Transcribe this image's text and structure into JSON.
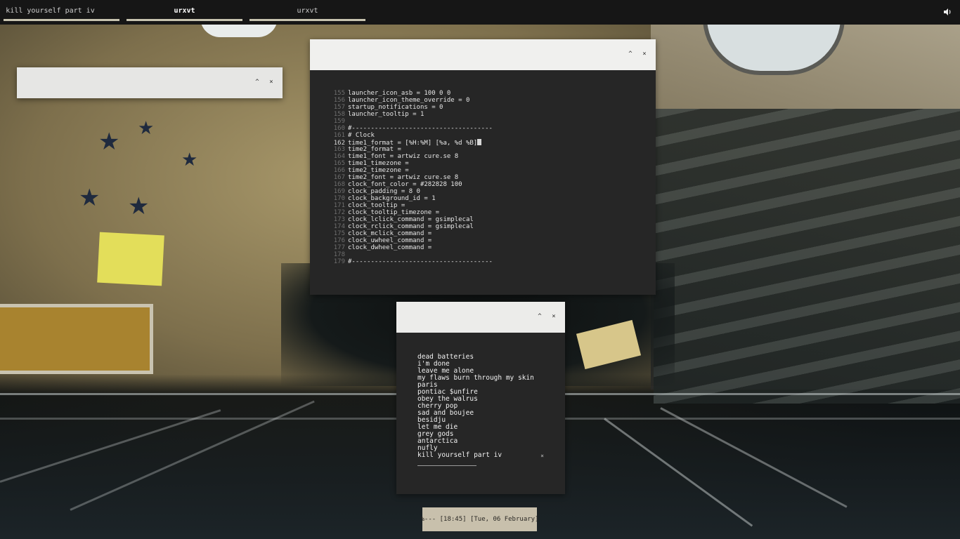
{
  "taskbar": {
    "tasks": [
      {
        "label": "kill yourself part iv",
        "active": false
      },
      {
        "label": "urxvt",
        "active": true
      },
      {
        "label": "urxvt",
        "active": false
      }
    ],
    "volume_icon": "speaker-icon"
  },
  "window_buttons": {
    "minimize": "^",
    "close": "×"
  },
  "terminal": {
    "lines": [
      {
        "n": "155",
        "text": "launcher_icon_asb = 100 0 0"
      },
      {
        "n": "156",
        "text": "launcher_icon_theme_override = 0"
      },
      {
        "n": "157",
        "text": "startup_notifications = 0"
      },
      {
        "n": "158",
        "text": "launcher_tooltip = 1"
      },
      {
        "n": "159",
        "text": ""
      },
      {
        "n": "160",
        "text": "#-------------------------------------"
      },
      {
        "n": "161",
        "text": "# Clock"
      },
      {
        "n": "162",
        "text": "time1_format = [%H:%M] [%a, %d %B]",
        "current": true
      },
      {
        "n": "163",
        "text": "time2_format ="
      },
      {
        "n": "164",
        "text": "time1_font = artwiz cure.se 8"
      },
      {
        "n": "165",
        "text": "time1_timezone ="
      },
      {
        "n": "166",
        "text": "time2_timezone ="
      },
      {
        "n": "167",
        "text": "time2_font = artwiz cure.se 8"
      },
      {
        "n": "168",
        "text": "clock_font_color = #282828 100"
      },
      {
        "n": "169",
        "text": "clock_padding = 8 0"
      },
      {
        "n": "170",
        "text": "clock_background_id = 1"
      },
      {
        "n": "171",
        "text": "clock_tooltip ="
      },
      {
        "n": "172",
        "text": "clock_tooltip_timezone ="
      },
      {
        "n": "173",
        "text": "clock_lclick_command = gsimplecal"
      },
      {
        "n": "174",
        "text": "clock_rclick_command = gsimplecal"
      },
      {
        "n": "175",
        "text": "clock_mclick_command ="
      },
      {
        "n": "176",
        "text": "clock_uwheel_command ="
      },
      {
        "n": "177",
        "text": "clock_dwheel_command ="
      },
      {
        "n": "178",
        "text": ""
      },
      {
        "n": "179",
        "text": "#-------------------------------------"
      }
    ]
  },
  "playlist": {
    "items": [
      "dead batteries",
      "i'm done",
      "leave me alone",
      "my flaws burn through my skin",
      "paris",
      "pontiac $unfire",
      "obey the walrus",
      "cherry pop",
      "sad and boujee",
      "besidju",
      "let me die",
      "grey gods",
      "antarctica",
      "nufly"
    ],
    "current_item": "kill yourself part iv",
    "remove_mark": "×"
  },
  "clock": {
    "text": "%--- [18:45] [Tue, 06 February]"
  },
  "colors": {
    "bar_bg": "#161616",
    "term_bg": "#262626",
    "titlebar": "#ececea",
    "clock_bg": "#c8c0ac"
  }
}
